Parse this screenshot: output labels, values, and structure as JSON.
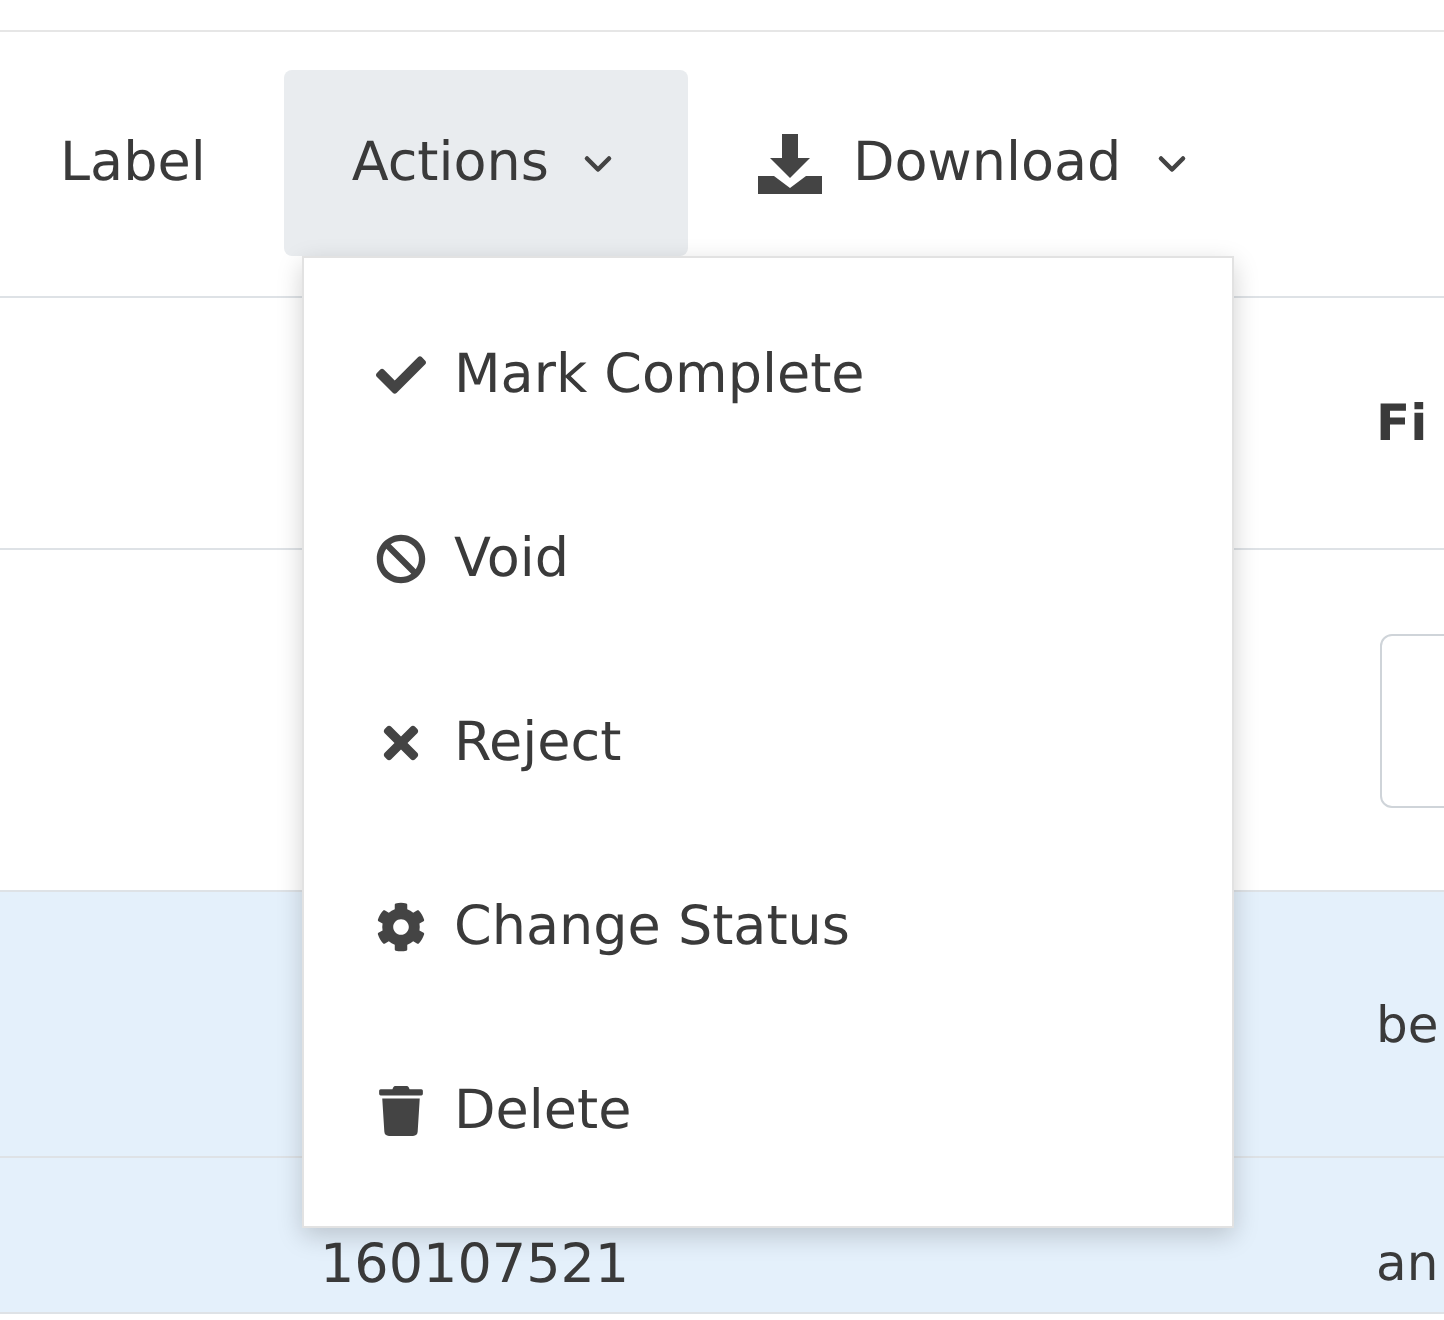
{
  "toolbar": [
    {
      "label": "Label",
      "kind": "plain",
      "selected": false
    },
    {
      "label": "Actions",
      "kind": "menu",
      "selected": true
    },
    {
      "label": "Download",
      "kind": "download",
      "selected": false
    }
  ],
  "menu": {
    "items": [
      {
        "label": "Mark Complete",
        "kind": "check"
      },
      {
        "label": "Void",
        "kind": "ban"
      },
      {
        "label": "Reject",
        "kind": "cross"
      },
      {
        "label": "Change Status",
        "kind": "gear"
      },
      {
        "label": "Delete",
        "kind": "trash"
      }
    ]
  },
  "table": {
    "header": "Fi",
    "rows": [
      {
        "column_2": "be"
      },
      {
        "column_1": "160107521",
        "column_2": "an"
      }
    ]
  }
}
